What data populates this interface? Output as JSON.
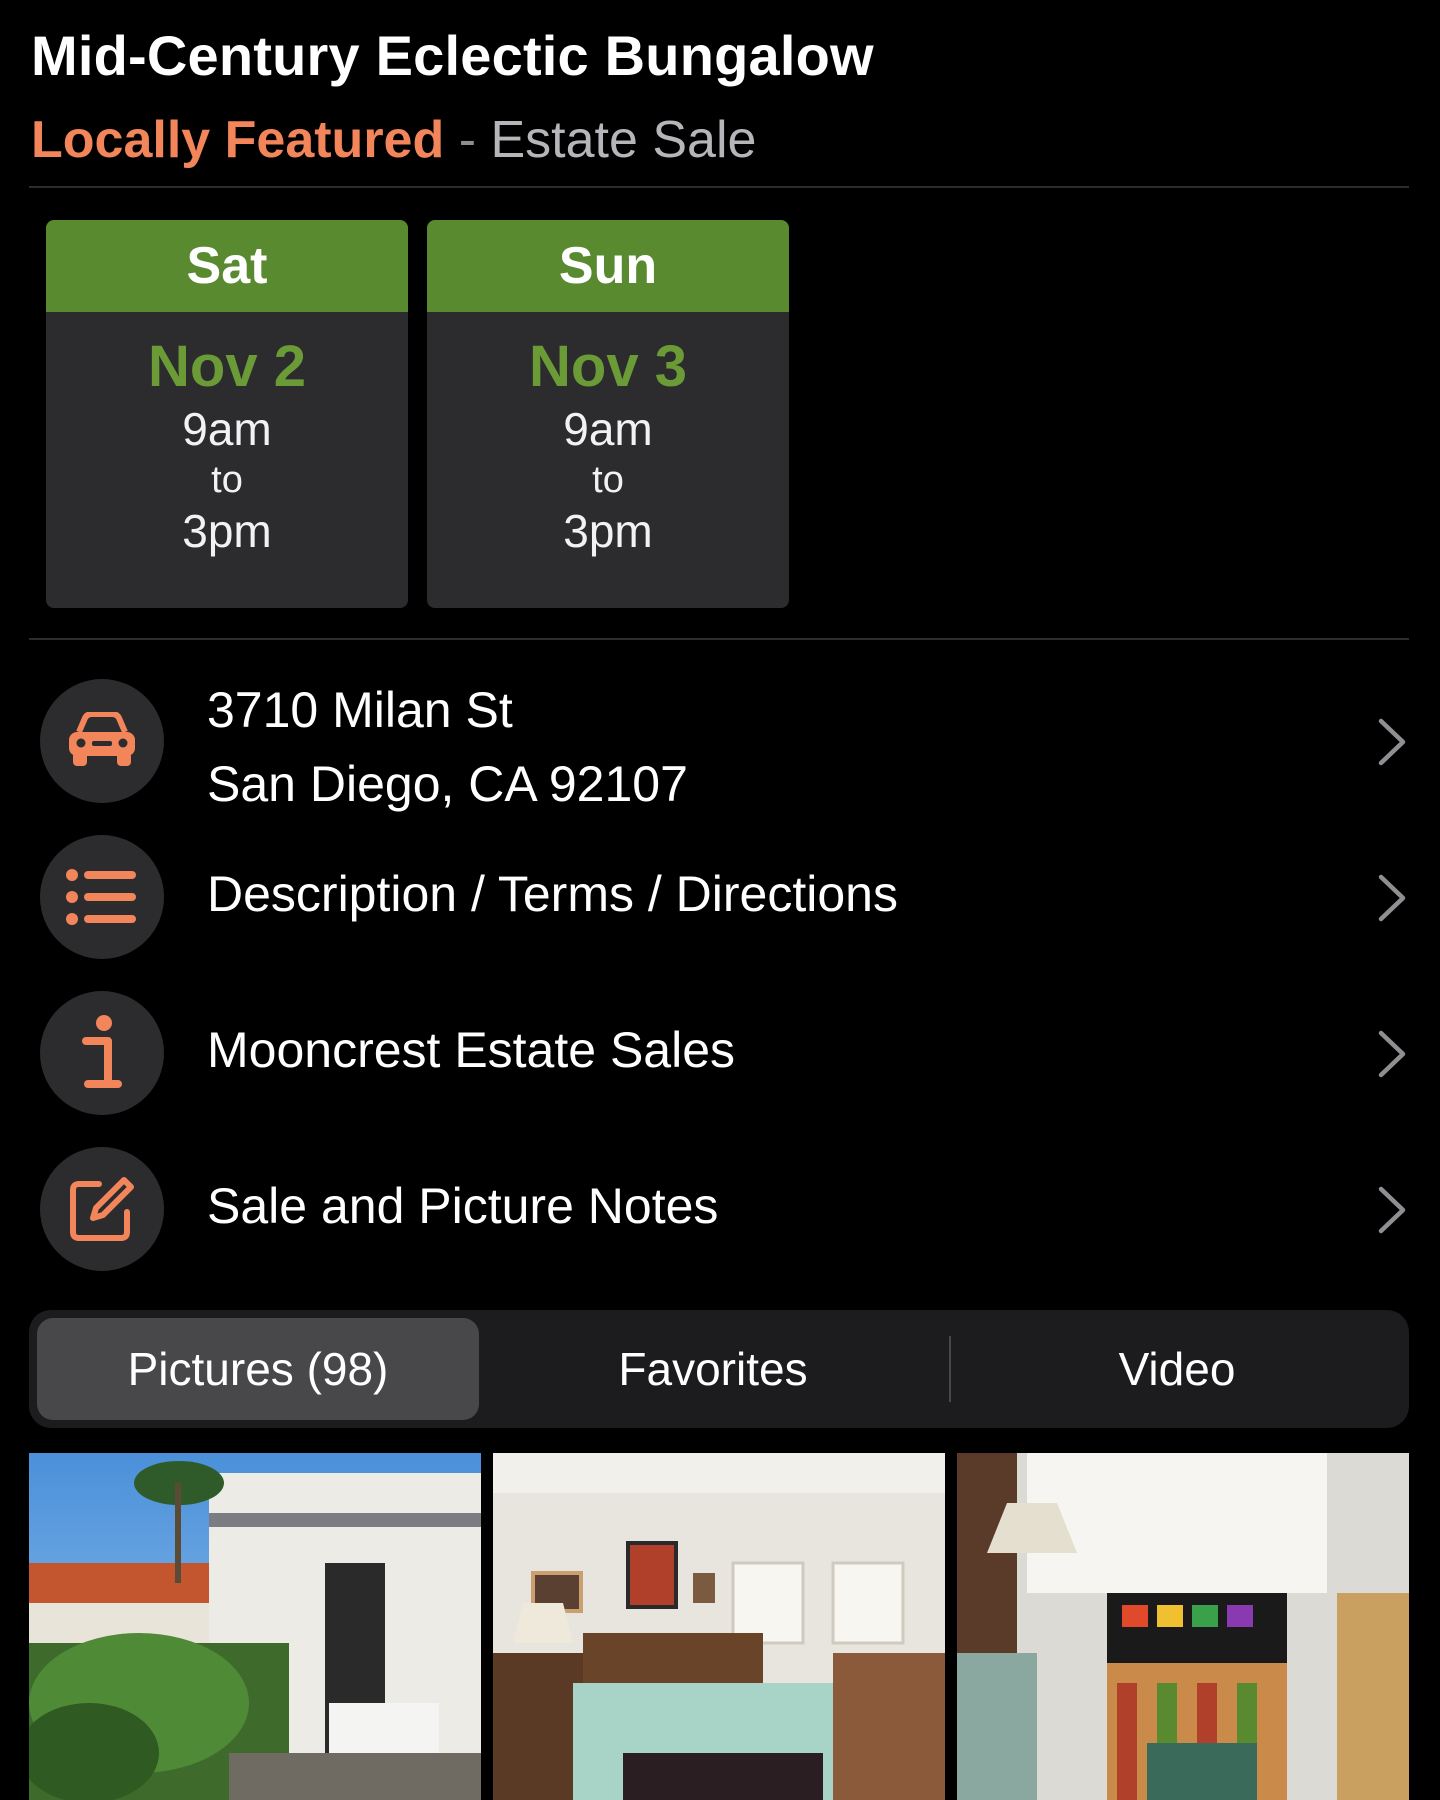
{
  "listing": {
    "title": "Mid-Century Eclectic Bungalow",
    "featured_label": "Locally Featured",
    "separator": "-",
    "sale_type": "Estate Sale"
  },
  "days": [
    {
      "weekday": "Sat",
      "date": "Nov 2",
      "start": "9am",
      "to": "to",
      "end": "3pm"
    },
    {
      "weekday": "Sun",
      "date": "Nov 3",
      "start": "9am",
      "to": "to",
      "end": "3pm"
    }
  ],
  "rows": {
    "address_line1": "3710 Milan St",
    "address_line2": "San Diego, CA 92107",
    "description": "Description / Terms / Directions",
    "company": "Mooncrest Estate Sales",
    "notes": "Sale and Picture Notes"
  },
  "icons": {
    "address": "car-icon",
    "description": "list-icon",
    "company": "info-icon",
    "notes": "edit-icon",
    "chevron": "chevron-right-icon"
  },
  "tabs": [
    {
      "label": "Pictures (98)",
      "active": true
    },
    {
      "label": "Favorites",
      "active": false
    },
    {
      "label": "Video",
      "active": false
    }
  ],
  "colors": {
    "accent": "#f2855a",
    "day_header": "#5a8a2f",
    "date_text": "#6b9b36",
    "card_bg": "#2c2c2e"
  },
  "photos": [
    "exterior-photo",
    "bedroom-photo",
    "armchair-photo"
  ]
}
